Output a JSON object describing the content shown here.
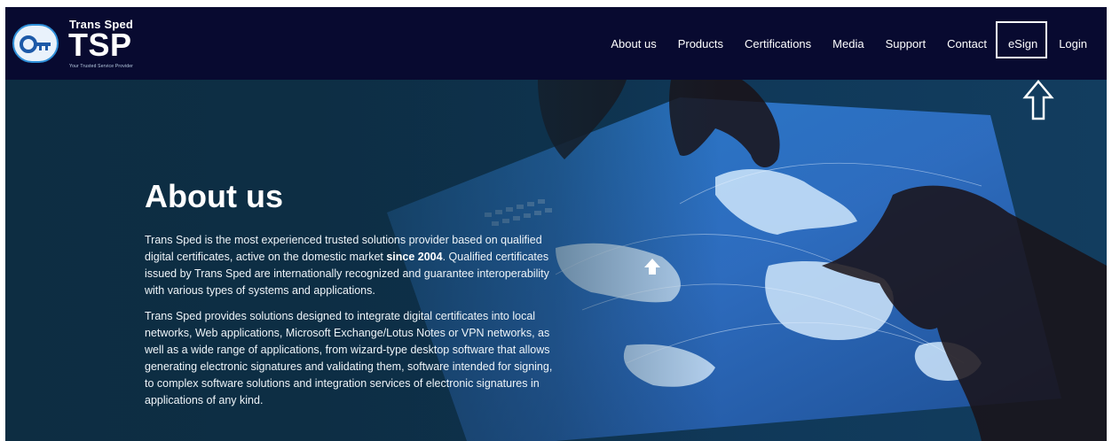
{
  "brand": {
    "top": "Trans Sped",
    "main": "TSP",
    "tagline": "Your Trusted Service Provider"
  },
  "nav": {
    "items": [
      {
        "label": "About us"
      },
      {
        "label": "Products"
      },
      {
        "label": "Certifications"
      },
      {
        "label": "Media"
      },
      {
        "label": "Support"
      },
      {
        "label": "Contact"
      },
      {
        "label": "eSign"
      },
      {
        "label": "Login"
      }
    ]
  },
  "hero": {
    "title": "About us",
    "p1_before": "Trans Sped is the most experienced trusted solutions provider based on qualified digital certificates, active on the domestic market ",
    "p1_bold": "since 2004",
    "p1_after": ". Qualified certificates issued by Trans Sped are internationally recognized and guarantee interoperability with various types of systems and applications.",
    "p2": "Trans Sped provides solutions designed to integrate digital certificates into local networks, Web applications, Microsoft Exchange/Lotus Notes or VPN networks, as well as a wide range of applications, from wizard-type desktop software that allows generating electronic signatures and validating them, software intended for signing, to complex software solutions and integration services of electronic signatures in applications of any kind."
  },
  "icons": {
    "annotation": "up-arrow-outline-icon",
    "scroll": "up-arrow-icon"
  },
  "colors": {
    "nav_bg": "#080a30",
    "hero_overlay": "#0d2d42",
    "text": "#ffffff"
  }
}
